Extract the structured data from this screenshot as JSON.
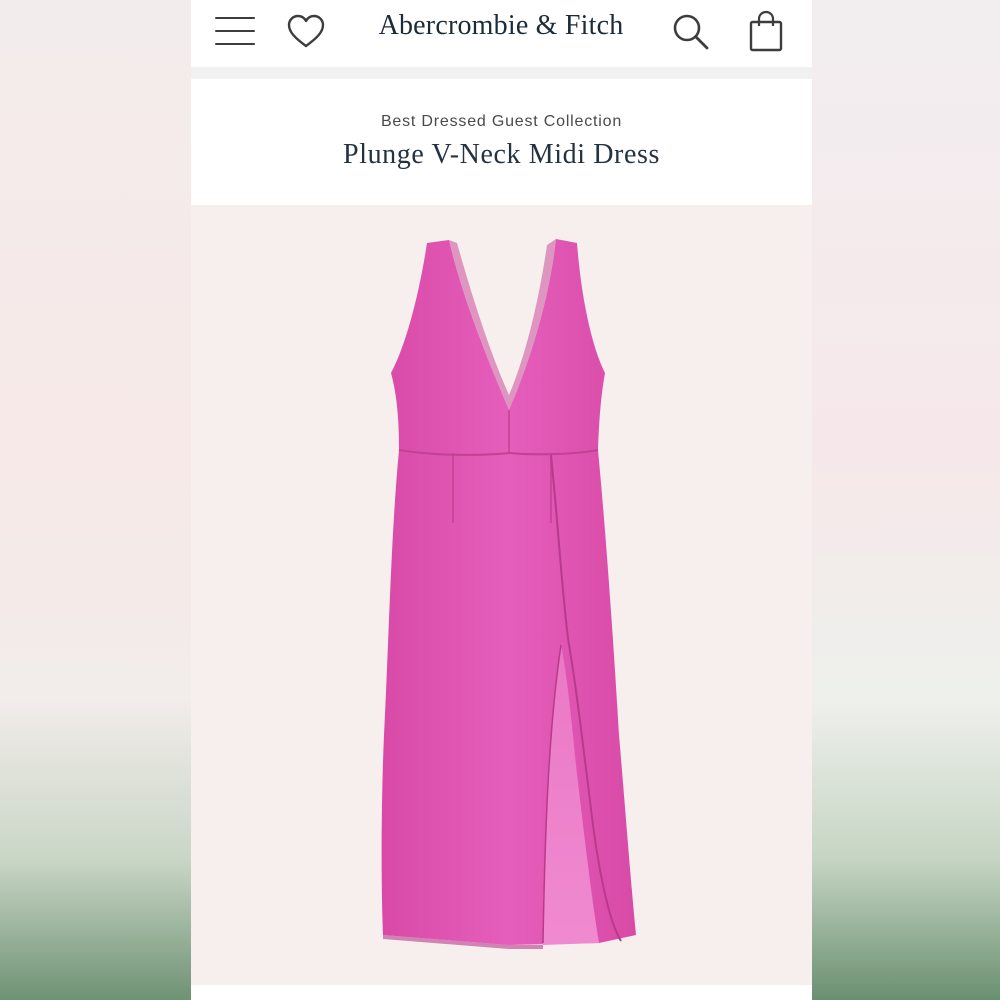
{
  "brand": {
    "logo_text": "Abercrombie & Fitch"
  },
  "header": {
    "icons": [
      "menu-icon",
      "heart-icon",
      "search-icon",
      "shopping-bag-icon"
    ]
  },
  "product": {
    "collection": "Best Dressed Guest Collection",
    "title": "Plunge V-Neck Midi Dress",
    "color": "#e35bb4"
  },
  "colors": {
    "header_bg": "#ffffff",
    "text_dark": "#243242",
    "image_bg": "#f6efed"
  }
}
